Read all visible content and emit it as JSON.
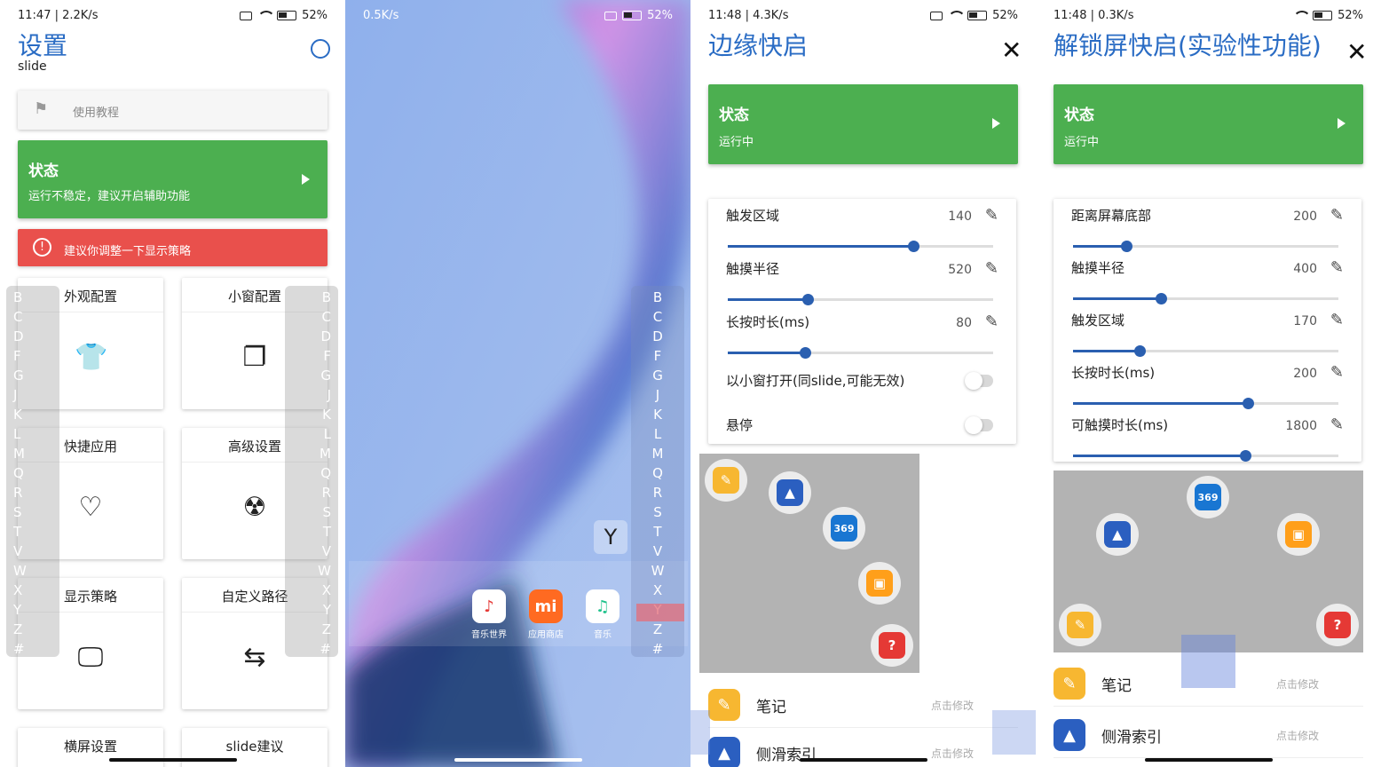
{
  "panel1": {
    "status": {
      "left": "11:47 | 2.2K/s",
      "battery": "52%"
    },
    "title": "设置",
    "subtitle": "slide",
    "tutorial": "使用教程",
    "status_card": {
      "title": "状态",
      "desc": "运行不稳定，建议开启辅助功能"
    },
    "warning": "建议你调整一下显示策略",
    "grid": [
      {
        "label": "外观配置",
        "icon": "shirt-icon"
      },
      {
        "label": "小窗配置",
        "icon": "window-icon"
      },
      {
        "label": "快捷应用",
        "icon": "heart-icon"
      },
      {
        "label": "高级设置",
        "icon": "radiation-icon"
      },
      {
        "label": "显示策略",
        "icon": "monitor-icon"
      },
      {
        "label": "自定义路径",
        "icon": "path-icon"
      },
      {
        "label": "横屏设置",
        "icon": ""
      },
      {
        "label": "slide建议",
        "icon": ""
      }
    ],
    "alpha_left": [
      "B",
      "C",
      "D",
      "F",
      "G",
      "J",
      "K",
      "L",
      "M",
      "Q",
      "R",
      "S",
      "T",
      "V",
      "W",
      "X",
      "Y",
      "Z",
      "#"
    ],
    "alpha_right": [
      "B",
      "C",
      "D",
      "F",
      "G",
      "J",
      "K",
      "L",
      "M",
      "Q",
      "R",
      "S",
      "T",
      "V",
      "W",
      "X",
      "Y",
      "Z",
      "#"
    ]
  },
  "panel2": {
    "status": {
      "left": "0.5K/s",
      "battery": "52%"
    },
    "letter_popup": "Y",
    "alpha": [
      "B",
      "C",
      "D",
      "F",
      "G",
      "J",
      "K",
      "L",
      "M",
      "Q",
      "R",
      "S",
      "T",
      "V",
      "W",
      "X",
      "Y",
      "Z",
      "#"
    ],
    "apps": [
      {
        "label": "音乐世界",
        "color": "#ffffff",
        "glyph": "♪",
        "glyph_color": "#e53935"
      },
      {
        "label": "应用商店",
        "color": "#ff6a21",
        "glyph": "mi",
        "glyph_color": "#ffffff"
      },
      {
        "label": "音乐",
        "color": "#ffffff",
        "glyph": "♫",
        "glyph_color": "#1ec28b"
      }
    ]
  },
  "panel3": {
    "status": {
      "left": "11:48 | 4.3K/s",
      "battery": "52%"
    },
    "title": "边缘快启",
    "status_card": {
      "title": "状态",
      "desc": "运行中"
    },
    "sliders": [
      {
        "label": "触发区域",
        "value": "140",
        "fraction": 0.7
      },
      {
        "label": "触摸半径",
        "value": "520",
        "fraction": 0.3
      },
      {
        "label": "长按时长(ms)",
        "value": "80",
        "fraction": 0.29
      }
    ],
    "toggles": [
      {
        "label": "以小窗打开(同slide,可能无效)"
      },
      {
        "label": "悬停"
      }
    ],
    "list": [
      {
        "label": "笔记",
        "hint": "点击修改",
        "color": "#f7b731"
      },
      {
        "label": "侧滑索引",
        "hint": "点击修改",
        "color": "#2b5fc0"
      }
    ]
  },
  "panel4": {
    "status": {
      "left": "11:48 | 0.3K/s",
      "battery": "52%"
    },
    "title": "解锁屏快启(实验性功能)",
    "status_card": {
      "title": "状态",
      "desc": "运行中"
    },
    "sliders": [
      {
        "label": "距离屏幕底部",
        "value": "200",
        "fraction": 0.2
      },
      {
        "label": "触摸半径",
        "value": "400",
        "fraction": 0.33
      },
      {
        "label": "触发区域",
        "value": "170",
        "fraction": 0.25
      },
      {
        "label": "长按时长(ms)",
        "value": "200",
        "fraction": 0.66
      },
      {
        "label": "可触摸时长(ms)",
        "value": "1800",
        "fraction": 0.65
      }
    ],
    "list": [
      {
        "label": "笔记",
        "hint": "点击修改",
        "color": "#f7b731"
      },
      {
        "label": "侧滑索引",
        "hint": "点击修改",
        "color": "#2b5fc0"
      }
    ]
  },
  "bubbles": {
    "note": {
      "color": "#f7b731",
      "glyph": "✎"
    },
    "rocket": {
      "color": "#2b5fc0",
      "glyph": "▲"
    },
    "app369": {
      "color": "#1976d2",
      "glyph": "369"
    },
    "chat": {
      "color": "#ff9f1a",
      "glyph": "▣"
    },
    "question": {
      "color": "#e53935",
      "glyph": "?"
    }
  }
}
